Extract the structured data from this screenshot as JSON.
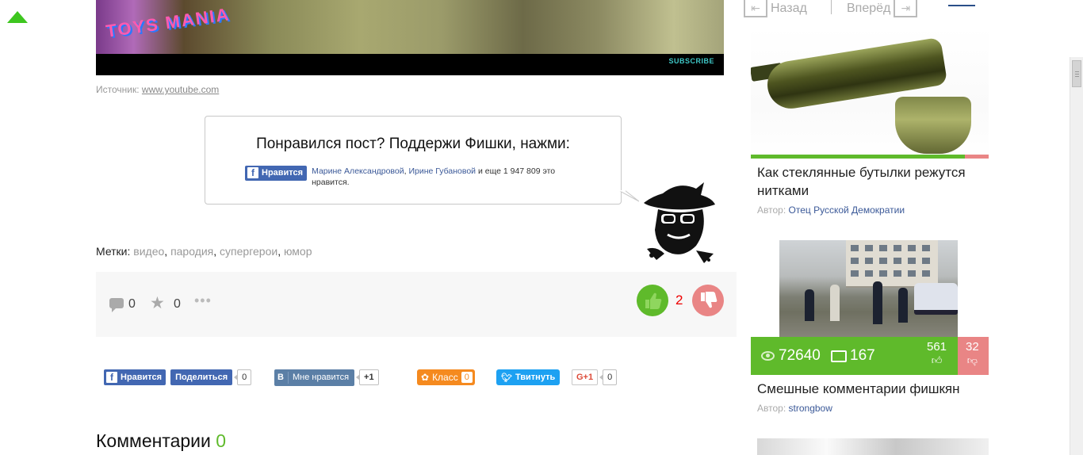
{
  "video": {
    "overlay_logo": "TOYS MANIA",
    "subscribe_label": "SUBSCRIBE"
  },
  "source": {
    "label": "Источник:",
    "link": "www.youtube.com"
  },
  "likebox": {
    "title": "Понравился пост? Поддержи Фишки, нажми:",
    "fb_button": "Нравится",
    "friend1": "Марине Александровой",
    "sep": ", ",
    "friend2": "Ирине Губановой",
    "rest": " и еще 1 947 809 это нравится."
  },
  "tags": {
    "label": "Метки:",
    "items": [
      "видео",
      "пародия",
      "супергерои",
      "юмор"
    ],
    "sep": ", "
  },
  "actions": {
    "comments_count": "0",
    "favorites_count": "0",
    "dots": "•••",
    "like_count": "2"
  },
  "share": {
    "fb_like": "Нравится",
    "fb_share": "Поделиться",
    "fb_count": "0",
    "vk_label": "Мне нравится",
    "vk_letter": "В",
    "vk_count": "+1",
    "ok_label": "Класс",
    "ok_count": "0",
    "tw_label": "Твитнуть",
    "gp_label": "G+1",
    "gp_count": "0"
  },
  "comments": {
    "title": "Комментарии",
    "count": "0"
  },
  "nav": {
    "back": "Назад",
    "forward": "Вперёд"
  },
  "sidebar": {
    "card1": {
      "title": "Как стеклянные бутылки режутся нитками",
      "author_label": "Автор:",
      "author": "Отец Русской Демократии",
      "likes_share": 0.9
    },
    "card2": {
      "title": "Смешные комментарии фишкян",
      "author_label": "Автор:",
      "author": "strongbow",
      "views": "72640",
      "comments": "167",
      "likes": "561",
      "dislikes": "32"
    }
  },
  "colors": {
    "accent_green": "#5fba2b",
    "dislike_red": "#e98585",
    "facebook": "#4267b2",
    "vk": "#5b7fa6",
    "ok": "#f58a1f",
    "twitter": "#1da1f2"
  }
}
